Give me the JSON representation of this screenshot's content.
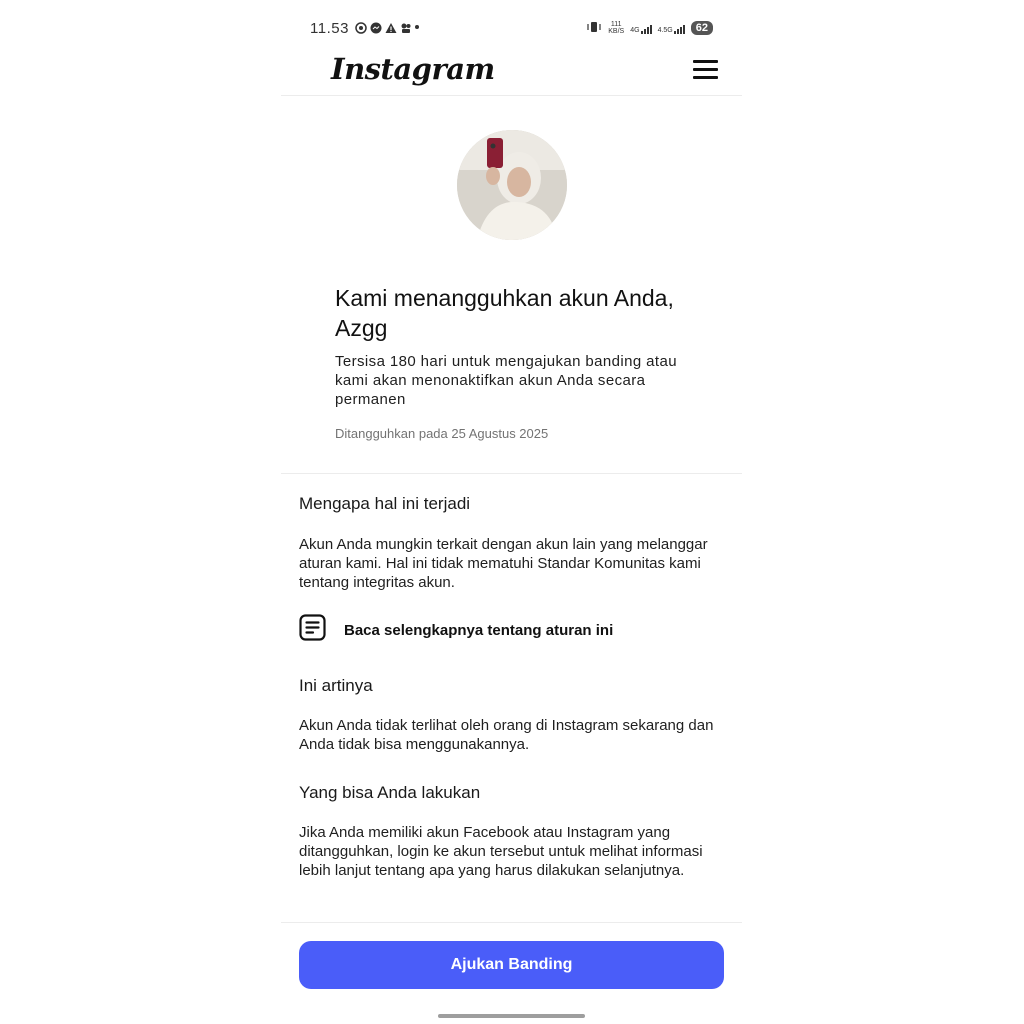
{
  "status_bar": {
    "time": "11.53",
    "net_speed": "111 KB/S",
    "net1": "4G",
    "net2": "4.5G",
    "battery": "62"
  },
  "header": {
    "logo": "Instagram"
  },
  "notice": {
    "title": "Kami menangguhkan akun Anda, Azgg",
    "subtitle": "Tersisa 180 hari untuk mengajukan banding atau kami akan menonaktifkan akun Anda secara permanen",
    "date": "Ditangguhkan pada 25 Agustus 2025"
  },
  "sections": {
    "why_title": "Mengapa hal ini terjadi",
    "why_body": "Akun Anda mungkin terkait dengan akun lain yang melanggar aturan kami. Hal ini tidak mematuhi Standar Komunitas kami tentang integritas akun.",
    "learn_more": "Baca selengkapnya tentang aturan ini",
    "meaning_title": "Ini artinya",
    "meaning_body": "Akun Anda tidak terlihat oleh orang di Instagram sekarang dan Anda tidak bisa menggunakannya.",
    "todo_title": "Yang bisa Anda lakukan",
    "todo_body": "Jika Anda memiliki akun Facebook atau Instagram yang ditangguhkan, login ke akun tersebut untuk melihat informasi lebih lanjut tentang apa yang harus dilakukan selanjutnya."
  },
  "footer": {
    "appeal_button": "Ajukan Banding"
  },
  "colors": {
    "accent": "#4a5df9"
  },
  "icons": [
    "whatsapp-icon",
    "messenger-icon",
    "warning-icon",
    "app-icon",
    "vibrate-icon",
    "menu-icon",
    "document-icon"
  ]
}
